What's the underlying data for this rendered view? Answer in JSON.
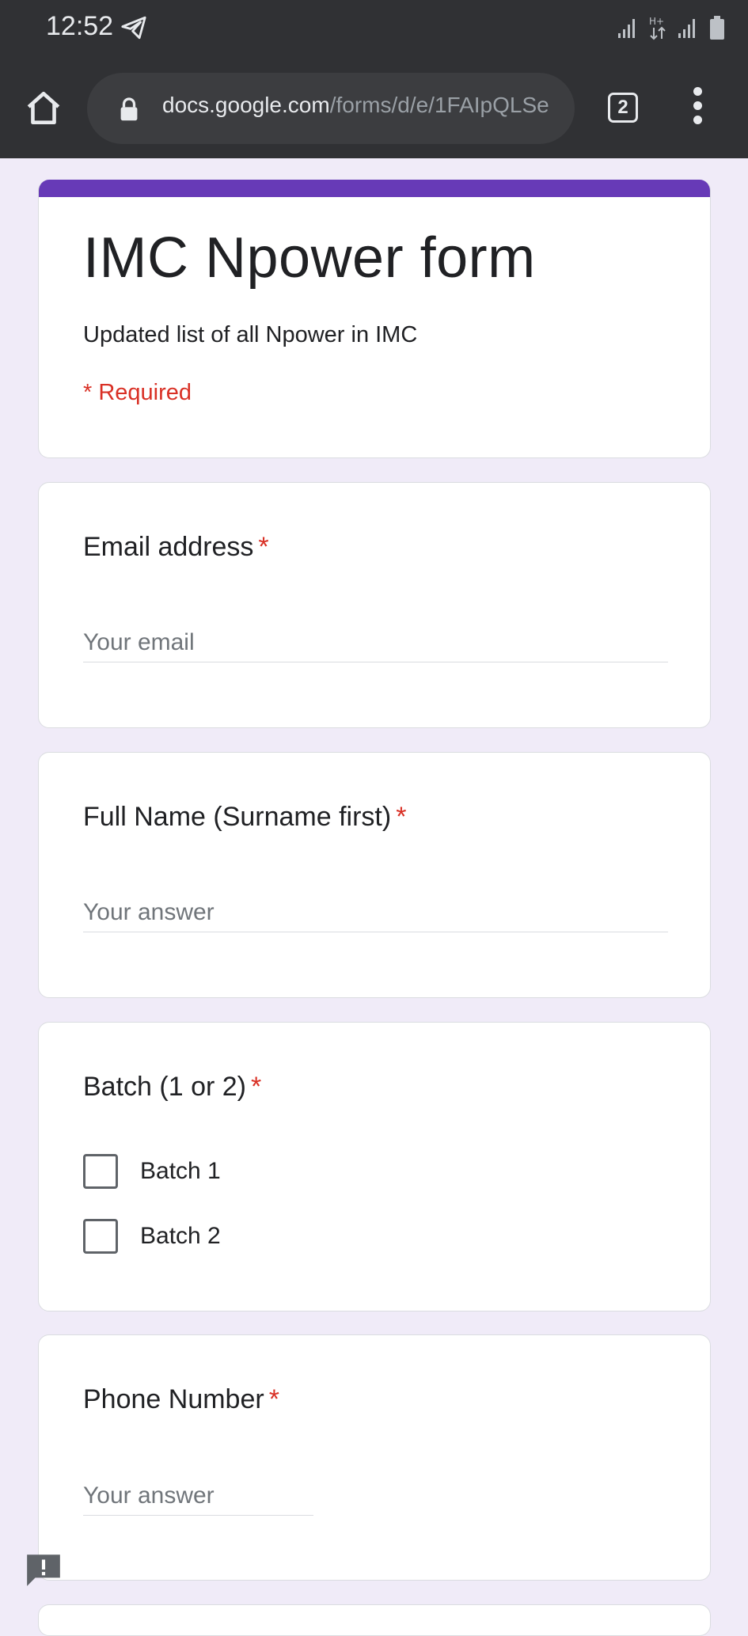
{
  "status_bar": {
    "time": "12:52"
  },
  "browser": {
    "url_host": "docs.google.com",
    "url_path": "/forms/d/e/1FAIpQLSe",
    "tab_count": "2"
  },
  "form": {
    "title": "IMC Npower form",
    "description": "Updated list of all Npower in IMC",
    "required_note": "* Required",
    "questions": [
      {
        "title": "Email address",
        "required_mark": "*",
        "placeholder": "Your email"
      },
      {
        "title": "Full Name (Surname first)",
        "required_mark": "*",
        "placeholder": "Your answer"
      },
      {
        "title": "Batch (1 or 2)",
        "required_mark": "*",
        "options": [
          "Batch 1",
          "Batch 2"
        ]
      },
      {
        "title": "Phone Number",
        "required_mark": "*",
        "placeholder": "Your answer"
      }
    ]
  },
  "colors": {
    "accent": "#673ab7",
    "page_background": "#f0ebf8",
    "required": "#d93025",
    "toolbar": "#303134"
  },
  "icons": [
    "telegram-send-icon",
    "signal-icon",
    "network-hplus-icon",
    "battery-icon",
    "home-icon",
    "lock-icon",
    "tabs-icon",
    "more-vert-icon",
    "feedback-icon"
  ]
}
